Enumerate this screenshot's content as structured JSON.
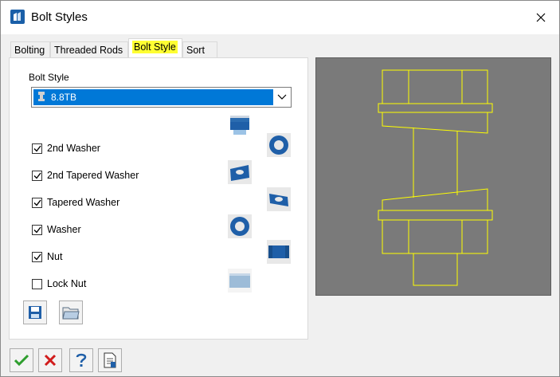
{
  "window": {
    "title": "Bolt Styles"
  },
  "tabs": [
    {
      "label": "Bolting"
    },
    {
      "label": "Threaded Rods"
    },
    {
      "label": "Bolt Style"
    },
    {
      "label": "Sort"
    }
  ],
  "bolt_style": {
    "label": "Bolt Style",
    "selected": "8.8TB"
  },
  "options": [
    {
      "label": "2nd Washer",
      "checked": true
    },
    {
      "label": "2nd Tapered Washer",
      "checked": true
    },
    {
      "label": "Tapered Washer",
      "checked": true
    },
    {
      "label": "Washer",
      "checked": true
    },
    {
      "label": "Nut",
      "checked": true
    },
    {
      "label": "Lock Nut",
      "checked": false
    }
  ],
  "colors": {
    "selection": "#0078d7",
    "tab_highlight": "#ffff33",
    "preview_background": "#7a7a7a",
    "preview_line": "#ffff00",
    "part_blue": "#1f6fb5"
  },
  "icons": {
    "save": "save-icon",
    "open": "open-folder-icon",
    "ok": "green-check-icon",
    "cancel": "red-x-icon",
    "help": "help-icon",
    "report": "document-icon"
  }
}
